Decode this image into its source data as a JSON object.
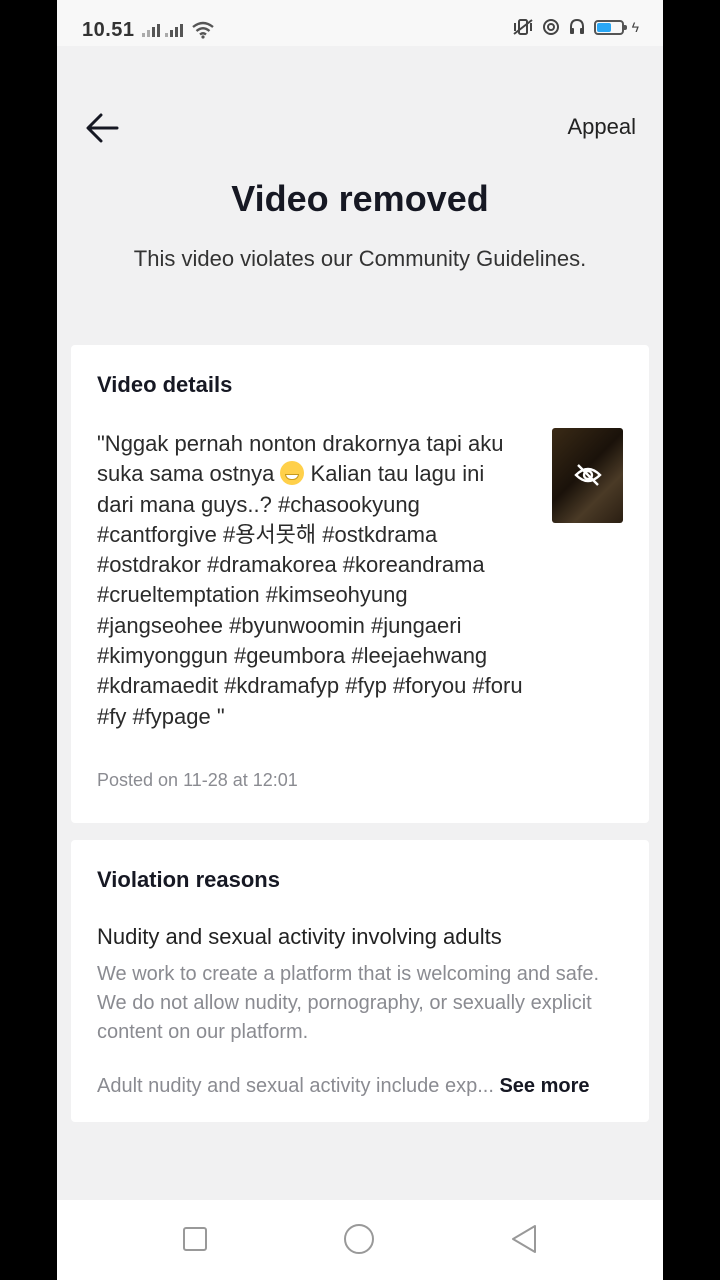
{
  "status_bar": {
    "time": "10.51",
    "icons": [
      "signal-icon",
      "signal-icon",
      "wifi-icon",
      "vibrate-icon",
      "alarm-icon",
      "headset-icon",
      "battery-icon",
      "charging-icon"
    ],
    "battery_level": 0.55,
    "battery_color": "#2aa7f5"
  },
  "header": {
    "back_icon": "arrow-left-icon",
    "appeal_label": "Appeal",
    "title": "Video removed",
    "subtitle": "This video violates our Community Guidelines."
  },
  "video_details": {
    "heading": "Video details",
    "description_part1": "\"Nggak pernah nonton drakornya tapi aku suka sama ostnya ",
    "description_part2": " Kalian tau lagu ini dari mana guys..? #chasookyung #cantforgive #용서못해 #ostkdrama #ostdrakor #dramakorea #koreandrama #crueltemptation #kimseohyung #jangseohee #byunwoomin #jungaeri #kimyonggun #geumbora #leejaehwang #kdramaedit #kdramafyp #fyp #foryou #foru #fy #fypage \"",
    "emoji": "grinning-face-icon",
    "posted": "Posted on 11-28 at 12:01",
    "thumbnail_icon": "eye-off-icon"
  },
  "violation": {
    "heading": "Violation reasons",
    "reason_title": "Nudity and sexual activity involving adults",
    "reason_text": "We work to create a platform that is welcoming and safe. We do not allow nudity, pornography, or sexually explicit content on our platform.",
    "reason_more": "Adult nudity and sexual activity include exp...",
    "see_more_label": " See more"
  },
  "nav_bar": {
    "icons": [
      "recent-apps-icon",
      "home-icon",
      "back-triangle-icon"
    ]
  }
}
